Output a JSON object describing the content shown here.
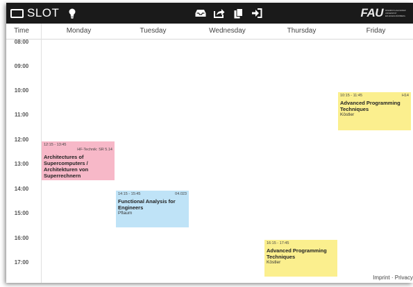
{
  "app": {
    "name": "SLOT",
    "logo": {
      "main": "FAU",
      "sub": [
        "FRIEDRICH-ALEXANDER",
        "UNIVERSITÄT",
        "ERLANGEN-NÜRNBERG"
      ]
    },
    "icons": [
      "screen-icon",
      "lightbulb-icon",
      "inbox-tray-icon",
      "share-icon",
      "copy-icon",
      "sign-in-icon"
    ]
  },
  "header": {
    "time_label": "Time",
    "days": [
      "Monday",
      "Tuesday",
      "Wednesday",
      "Thursday",
      "Friday"
    ]
  },
  "times": [
    "08:00",
    "09:00",
    "10:00",
    "11:00",
    "12:00",
    "13:00",
    "14:00",
    "15:00",
    "16:00",
    "17:00"
  ],
  "events": [
    {
      "day": 0,
      "start": "12:15",
      "end": "13:45",
      "time": "12:15 - 13:45",
      "room": "HF-Technik: SR 5.14",
      "title": "Architectures of Supercomputers / Architekturen von Superrechnern",
      "lecturer": "",
      "color": "#f7b8c8"
    },
    {
      "day": 1,
      "start": "14:15",
      "end": "15:45",
      "time": "14:15 - 15:45",
      "room": "04.023",
      "title": "Functional Analysis for Engineers",
      "lecturer": "Pflaum",
      "color": "#bfe3f7"
    },
    {
      "day": 3,
      "start": "16:15",
      "end": "17:45",
      "time": "16:15 - 17:45",
      "room": "",
      "title": "Advanced Programming Techniques",
      "lecturer": "Köstler",
      "color": "#fbef8e"
    },
    {
      "day": 4,
      "start": "10:15",
      "end": "11:45",
      "time": "10:15 - 11:45",
      "room": "H14",
      "title": "Advanced Programming Techniques",
      "lecturer": "Köstler",
      "color": "#fbef8e"
    }
  ],
  "footer": {
    "imprint": "Imprint",
    "separator": "·",
    "privacy": "Privacy"
  }
}
